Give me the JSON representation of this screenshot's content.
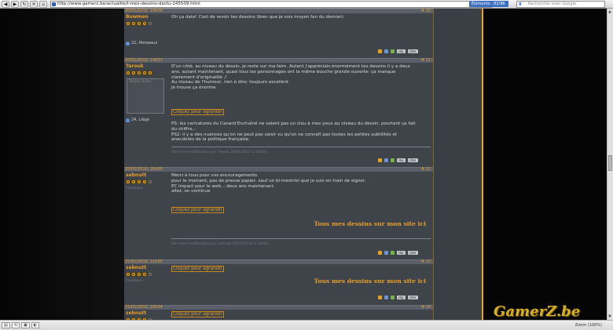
{
  "browser": {
    "back_icon": "◀",
    "forward_icon": "▶",
    "refresh_icon": "↻",
    "close_icon": "✕",
    "home_icon": "⌂",
    "url": "http://www.gamerz.be/actualite/t-mes-dessins-dactu-245509.html",
    "elements": "Éléments : 82/96",
    "search_placeholder": "Rechercher avec Google",
    "zoom": "Zoom (100%)"
  },
  "posts": [
    {
      "date": "20/01/2010, 14h06",
      "number": "# 10",
      "author": "Bowmen",
      "ranks": 4,
      "ranks_total": 5,
      "user": "22, Herseaux",
      "message": [
        "Oh ça date! Cool de revoir tes dessins (bien que je sois moyen fan du dernier)"
      ]
    },
    {
      "date": "20/01/2010, 14h37",
      "number": "# 11",
      "author": "Tarouk",
      "ranks": 5,
      "ranks_total": 5,
      "avatar_label": "Tarouk Ardor",
      "user": "24, Liège",
      "message": [
        "D'un côté, au niveau du dessin, je reste sur ma faim. Autant j'appréciais énormément tes dessins il y a deux",
        "ans, autant maintenant, quasi tous les personnages ont la même bouche grande ouverte: ça manque",
        "clairement d'originalité :/",
        "",
        "Au niveau de l'humour, rien à dire: toujours excellent",
        "",
        "Je trouve ça énorme"
      ],
      "link": "Cliquez pour agrandir",
      "ps": [
        "PS: les caricatures du Canard Enchaîné ne valent pas un clou à mes yeux au niveau du dessin, pourtant ça fait",
        "du chiffre...",
        "PS2: il y a des nuances qu'on ne peut pas saisir vu qu'on ne connaît pas toutes les petites subtilités et",
        "anecdotes de la politique française."
      ],
      "edit": "Dernière modification par Tarouk 20/01/2010 à 14h54."
    },
    {
      "date": "20/01/2010, 20h26",
      "number": "# 12",
      "author": "sebnutt",
      "ranks": 4,
      "ranks_total": 5,
      "role": "Fanatique",
      "message": [
        "Merci à tous pour vos encouragements.",
        "pour le moment, pas de presse papier, sauf un bi-mestriel que je suis en train de signer.",
        "PC impact pour le web... deux ans maintenant.",
        "",
        "allez, on continue"
      ],
      "link": "Cliquez pour agrandir",
      "signature": "Tous mes dessins sur mon site ici",
      "edit": "Dernière modification par sebnutt 20/01/2010 à 20h42."
    },
    {
      "date": "21/01/2010, 11h35",
      "number": "# 13",
      "author": "sebnutt",
      "ranks": 4,
      "ranks_total": 5,
      "role": "Fanatique",
      "link": "Cliquez pour agrandir",
      "signature": "Tous mes dessins sur mon site ici"
    },
    {
      "date": "21/01/2010, 16h34",
      "number": "# 14",
      "author": "sebnutt",
      "ranks": 4,
      "ranks_total": 5,
      "link": "Cliquez pour agrandir"
    }
  ],
  "actions": {
    "quote": "citer",
    "reply": "rép"
  },
  "footer": {
    "brand": "GamerZ.be"
  }
}
